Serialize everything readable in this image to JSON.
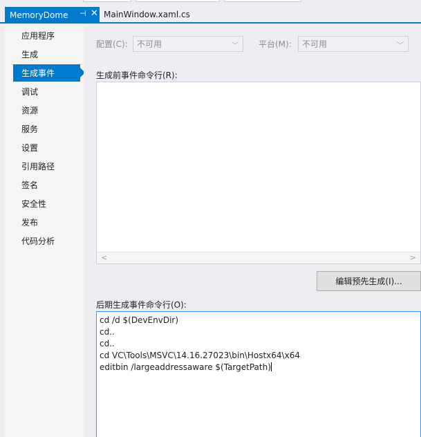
{
  "tabs": {
    "active": {
      "label": "MemoryDome",
      "pin": "⊣",
      "close": "✕"
    },
    "inactive": {
      "label": "MainWindow.xaml.cs"
    }
  },
  "sidebar": {
    "items": [
      {
        "label": "应用程序"
      },
      {
        "label": "生成"
      },
      {
        "label": "生成事件",
        "active": true
      },
      {
        "label": "调试"
      },
      {
        "label": "资源"
      },
      {
        "label": "服务"
      },
      {
        "label": "设置"
      },
      {
        "label": "引用路径"
      },
      {
        "label": "签名"
      },
      {
        "label": "安全性"
      },
      {
        "label": "发布"
      },
      {
        "label": "代码分析"
      }
    ]
  },
  "config": {
    "config_label": "配置(C):",
    "config_value": "不可用",
    "platform_label": "平台(M):",
    "platform_value": "不可用"
  },
  "prebuild": {
    "label": "生成前事件命令行(R):",
    "value": "",
    "edit_button": "编辑预先生成(I)..."
  },
  "postbuild": {
    "label": "后期生成事件命令行(O):",
    "lines": [
      "cd /d $(DevEnvDir)",
      "cd..",
      "cd..",
      "cd VC\\Tools\\MSVC\\14.16.27023\\bin\\Hostx64\\x64",
      "editbin /largeaddressaware $(TargetPath)"
    ]
  },
  "colors": {
    "accent": "#007acc",
    "background": "#eeeef2",
    "focus_border": "#3399ff"
  }
}
